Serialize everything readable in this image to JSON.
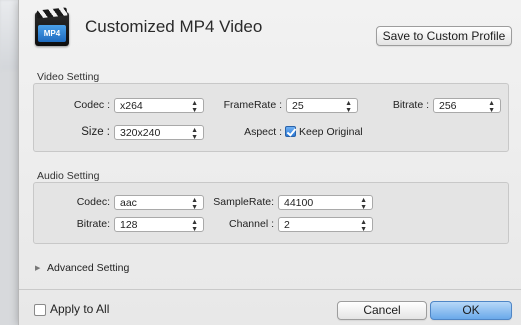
{
  "dialog": {
    "title": "Customized MP4 Video",
    "icon": "mp4-video-icon",
    "icon_text": "MP4"
  },
  "header": {
    "save_profile_label": "Save to Custom Profile"
  },
  "video_setting": {
    "group_title": "Video Setting",
    "codec": {
      "label": "Codec :",
      "value": "x264"
    },
    "framerate": {
      "label": "FrameRate :",
      "value": "25"
    },
    "bitrate": {
      "label": "Bitrate :",
      "value": "256"
    },
    "size": {
      "label": "Size :",
      "value": "320x240"
    },
    "aspect": {
      "label": "Aspect :",
      "checkbox_label": "Keep Original",
      "checked": true
    }
  },
  "audio_setting": {
    "group_title": "Audio Setting",
    "codec": {
      "label": "Codec:",
      "value": "aac"
    },
    "samplerate": {
      "label": "SampleRate:",
      "value": "44100"
    },
    "bitrate": {
      "label": "Bitrate:",
      "value": "128"
    },
    "channel": {
      "label": "Channel :",
      "value": "2"
    }
  },
  "advanced": {
    "label": "Advanced Setting",
    "expanded": false
  },
  "footer": {
    "apply_all_label": "Apply to All",
    "apply_all_checked": false,
    "cancel_label": "Cancel",
    "ok_label": "OK"
  },
  "colors": {
    "accent": "#2a78d6",
    "dialog_bg": "#ececec",
    "group_bg": "#e4e4e4"
  }
}
